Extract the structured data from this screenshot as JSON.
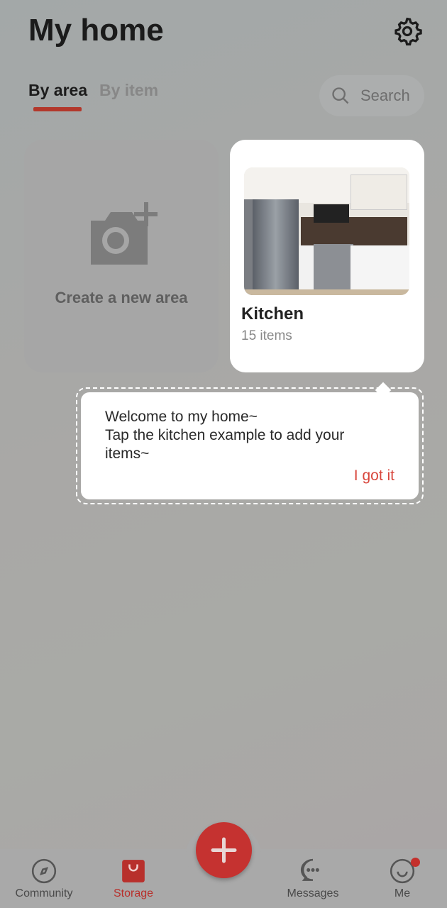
{
  "header": {
    "title": "My home",
    "settings_icon": "gear-icon"
  },
  "tabs": [
    {
      "label": "By area",
      "active": true
    },
    {
      "label": "By item",
      "active": false
    }
  ],
  "search": {
    "placeholder": "Search"
  },
  "areas": {
    "create_label": "Create a new area",
    "items": [
      {
        "name": "Kitchen",
        "count": "15 items"
      }
    ]
  },
  "tooltip": {
    "line1": "Welcome to my home~",
    "line2": "Tap the kitchen example to add your items~",
    "action": "I got it"
  },
  "nav": {
    "items": [
      {
        "label": "Community",
        "icon": "compass-icon"
      },
      {
        "label": "Storage",
        "icon": "bag-icon",
        "active": true
      },
      {
        "label": "Messages",
        "icon": "chat-icon"
      },
      {
        "label": "Me",
        "icon": "smile-icon",
        "badge": true
      }
    ],
    "fab_icon": "plus-icon"
  },
  "colors": {
    "accent": "#c53230"
  }
}
